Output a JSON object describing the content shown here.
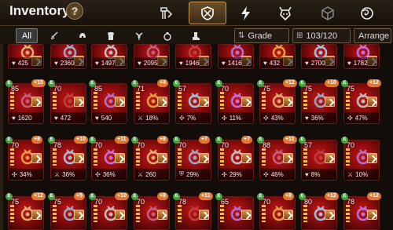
{
  "header": {
    "title": "Inventory",
    "help_label": "?",
    "category_tabs": [
      {
        "icon": "artifact-tab-icon",
        "active": false
      },
      {
        "icon": "accessory-tab-icon",
        "active": true
      },
      {
        "icon": "lightning-tab-icon",
        "active": false
      },
      {
        "icon": "demon-tab-icon",
        "active": false
      },
      {
        "icon": "cube-tab-icon",
        "active": false
      },
      {
        "icon": "portal-tab-icon",
        "active": false
      }
    ]
  },
  "filters": {
    "tabs": [
      {
        "label": "All",
        "active": true
      },
      {
        "icon": "weapon-icon"
      },
      {
        "icon": "helmet-icon"
      },
      {
        "icon": "chest-icon"
      },
      {
        "icon": "gloves-icon"
      },
      {
        "icon": "ring-icon"
      },
      {
        "icon": "boots-icon"
      }
    ],
    "sort_label": "Grade",
    "capacity": "103/120",
    "arrange_label": "Arrange"
  },
  "colors": {
    "card_bg": "#a31010",
    "plus_badge": "#e8762a",
    "new_badge": "#3ea83e",
    "set_badge": "#d9944a"
  },
  "rows": [
    [
      {
        "stat_icon": "heart",
        "value": "425"
      },
      {
        "stat_icon": "heart",
        "value": "2360"
      },
      {
        "stat_icon": "heart",
        "value": "1497"
      },
      {
        "stat_icon": "heart",
        "value": "2095"
      },
      {
        "stat_icon": "heart",
        "value": "1946"
      },
      {
        "stat_icon": "heart",
        "value": "1416"
      },
      {
        "stat_icon": "heart",
        "value": "432"
      },
      {
        "stat_icon": "heart",
        "value": "2700"
      },
      {
        "stat_icon": "heart",
        "value": "1782"
      }
    ],
    [
      {
        "level": "85",
        "plus": "+10",
        "stat_icon": "heart",
        "value": "1620"
      },
      {
        "level": "70",
        "stat_icon": "heart",
        "value": "472"
      },
      {
        "level": "85",
        "stat_icon": "heart",
        "value": "540"
      },
      {
        "level": "71",
        "plus": "+4",
        "stat_icon": "sword",
        "value": "18%"
      },
      {
        "level": "57",
        "stat_icon": "crit",
        "value": "7%"
      },
      {
        "level": "70",
        "stat_icon": "crit",
        "value": "11%"
      },
      {
        "level": "75",
        "plus": "+12",
        "stat_icon": "crit",
        "value": "43%"
      },
      {
        "level": "75",
        "plus": "+10",
        "stat_icon": "heart",
        "value": "36%"
      },
      {
        "level": "75",
        "plus": "+12",
        "stat_icon": "crit",
        "value": "47%"
      }
    ],
    [
      {
        "level": "70",
        "plus": "+8",
        "stat_icon": "crit",
        "value": "34%"
      },
      {
        "level": "78",
        "plus": "+10",
        "stat_icon": "sword",
        "value": "36%"
      },
      {
        "level": "70",
        "plus": "+11",
        "stat_icon": "crit",
        "value": "36%"
      },
      {
        "level": "70",
        "plus": "+8",
        "stat_icon": "sword",
        "value": "260"
      },
      {
        "level": "70",
        "plus": "+7",
        "stat_icon": "shield",
        "value": "29%"
      },
      {
        "level": "70",
        "plus": "+7",
        "stat_icon": "crit",
        "value": "29%"
      },
      {
        "level": "88",
        "plus": "+11",
        "stat_icon": "crit",
        "value": "46%"
      },
      {
        "level": "57",
        "stat_icon": "heart",
        "value": "8%"
      },
      {
        "level": "70",
        "stat_icon": "sword",
        "value": "10%"
      }
    ],
    [
      {
        "level": "75",
        "plus": "+12"
      },
      {
        "level": "75",
        "plus": "+5"
      },
      {
        "level": "70",
        "plus": "+10"
      },
      {
        "level": "70",
        "plus": "+8"
      },
      {
        "level": "78",
        "plus": "+11"
      },
      {
        "level": "65"
      },
      {
        "level": "70",
        "plus": "+8"
      },
      {
        "level": "80",
        "plus": "+12"
      },
      {
        "level": "78",
        "plus": "+12"
      }
    ]
  ]
}
